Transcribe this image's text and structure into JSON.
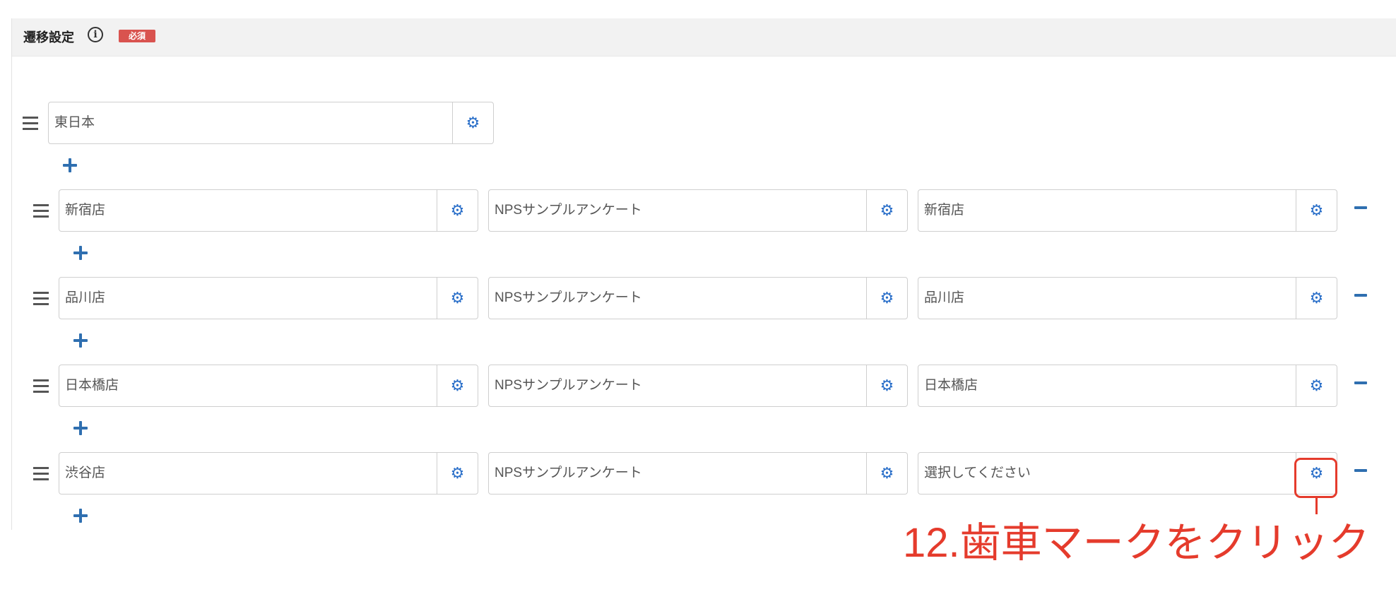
{
  "section": {
    "title": "遷移設定",
    "info_glyph": "i",
    "required_label": "必須"
  },
  "root": {
    "value": "東日本"
  },
  "rows": [
    {
      "store": "新宿店",
      "survey": "NPSサンプルアンケート",
      "destination": "新宿店"
    },
    {
      "store": "品川店",
      "survey": "NPSサンプルアンケート",
      "destination": "品川店"
    },
    {
      "store": "日本橋店",
      "survey": "NPSサンプルアンケート",
      "destination": "日本橋店"
    },
    {
      "store": "渋谷店",
      "survey": "NPSサンプルアンケート",
      "destination": "選択してください"
    }
  ],
  "icons": {
    "gear": "gear-icon",
    "drag": "drag-handle-icon",
    "add": "plus-icon",
    "remove": "minus-icon"
  },
  "annotation": {
    "text": "12.歯車マークをクリック",
    "color": "#e53b2c"
  },
  "colors": {
    "accent": "#2a6fc9",
    "required_badge": "#d9534f",
    "header_bg": "#f2f2f2"
  }
}
